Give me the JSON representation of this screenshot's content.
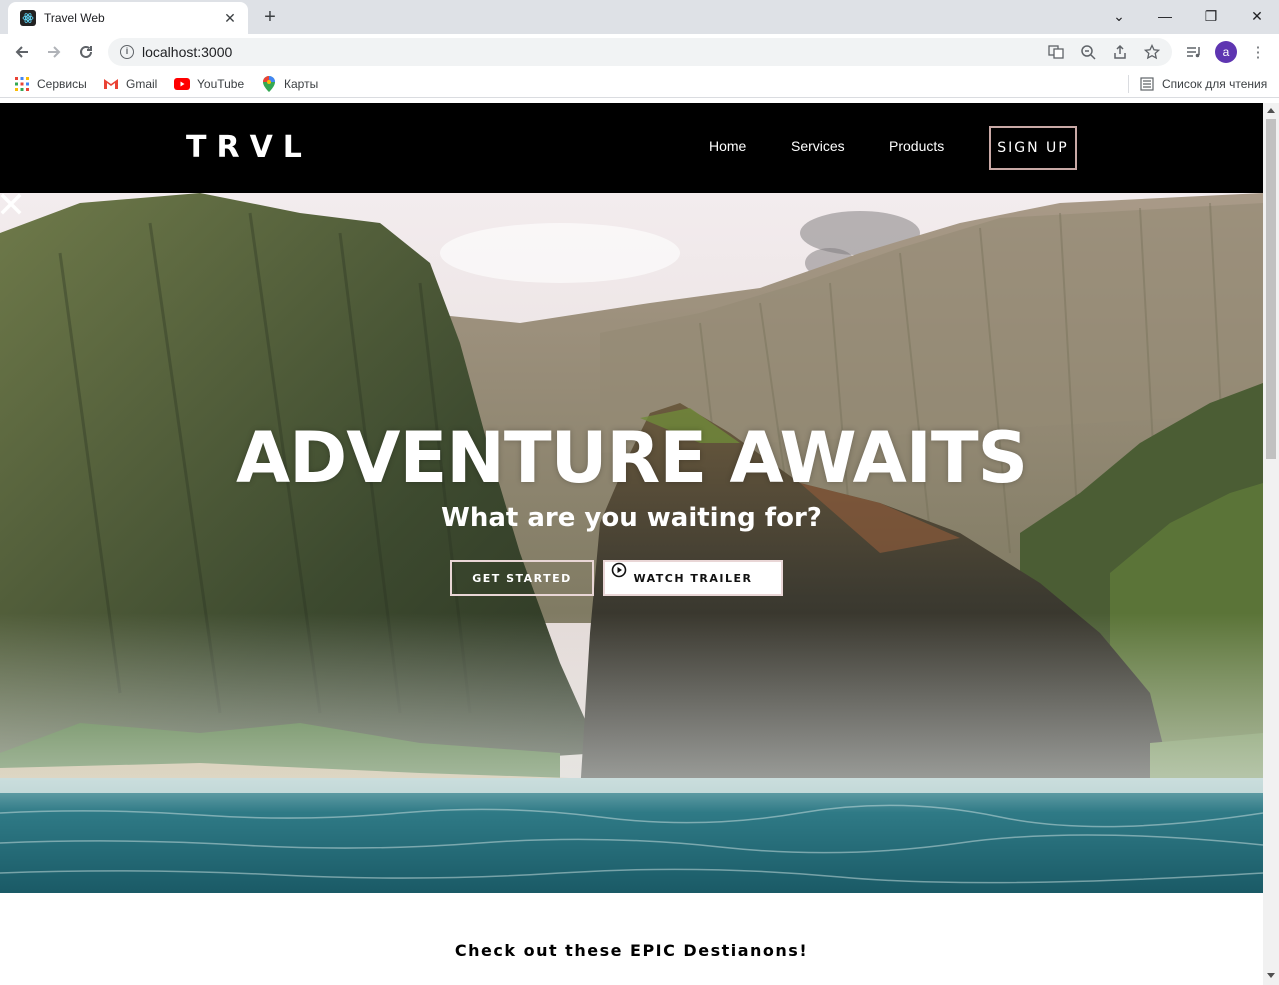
{
  "browser": {
    "tab_title": "Travel Web",
    "url": "localhost:3000",
    "avatar_letter": "a",
    "bookmarks": [
      "Сервисы",
      "Gmail",
      "YouTube",
      "Карты"
    ],
    "reading_list": "Список для чтения"
  },
  "site": {
    "logo": "TRVL",
    "menu": [
      "Home",
      "Services",
      "Products"
    ],
    "signup": "SIGN UP"
  },
  "hero": {
    "title": "ADVENTURE AWAITS",
    "subtitle": "What are you waiting for?",
    "get_started": "GET STARTED",
    "watch_trailer": "WATCH TRAILER"
  },
  "section": {
    "title": "Check out these EPIC Destianons!"
  },
  "colors": {
    "nav_bg": "#000000",
    "button_border": "#c9a9a6",
    "avatar": "#5e35b1"
  }
}
